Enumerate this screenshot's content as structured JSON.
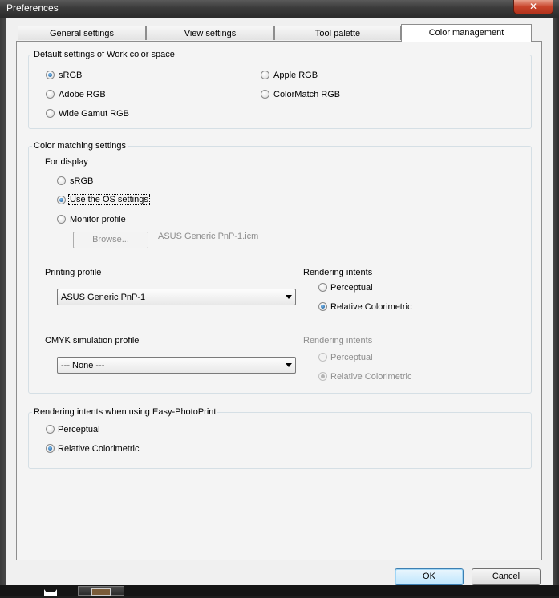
{
  "window": {
    "title": "Preferences",
    "close_glyph": "✕"
  },
  "tabs": [
    {
      "label": "General settings"
    },
    {
      "label": "View settings"
    },
    {
      "label": "Tool palette"
    },
    {
      "label": "Color management",
      "active": true
    }
  ],
  "work_space": {
    "group_label": "Default settings of Work color space",
    "options": [
      {
        "label": "sRGB",
        "checked": true
      },
      {
        "label": "Adobe RGB",
        "checked": false
      },
      {
        "label": "Wide Gamut RGB",
        "checked": false
      },
      {
        "label": "Apple RGB",
        "checked": false
      },
      {
        "label": "ColorMatch RGB",
        "checked": false
      }
    ]
  },
  "color_matching": {
    "group_label": "Color matching settings",
    "for_display_label": "For display",
    "display_options": [
      {
        "label": "sRGB",
        "checked": false
      },
      {
        "label": "Use the OS settings",
        "checked": true
      },
      {
        "label": "Monitor profile",
        "checked": false
      }
    ],
    "browse_label": "Browse...",
    "monitor_profile_file": "ASUS Generic PnP-1.icm",
    "printing_profile_label": "Printing profile",
    "printing_profile_value": "ASUS Generic PnP-1",
    "rendering_intents_label": "Rendering intents",
    "print_intents": [
      {
        "label": "Perceptual",
        "checked": false
      },
      {
        "label": "Relative Colorimetric",
        "checked": true
      }
    ],
    "cmyk_profile_label": "CMYK simulation profile",
    "cmyk_profile_value": "--- None ---",
    "cmyk_intents_label": "Rendering intents",
    "cmyk_intents": [
      {
        "label": "Perceptual",
        "checked": false
      },
      {
        "label": "Relative Colorimetric",
        "checked": true
      }
    ]
  },
  "easy_photoprint": {
    "group_label": "Rendering intents when using Easy-PhotoPrint",
    "options": [
      {
        "label": "Perceptual",
        "checked": false
      },
      {
        "label": "Relative Colorimetric",
        "checked": true
      }
    ]
  },
  "buttons": {
    "ok": "OK",
    "cancel": "Cancel"
  }
}
